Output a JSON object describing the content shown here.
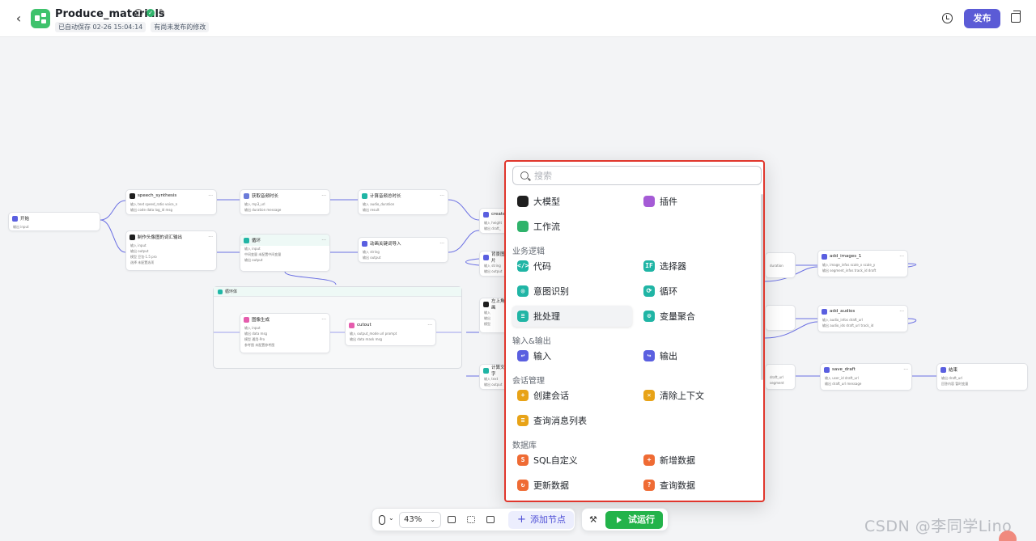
{
  "header": {
    "title": "Produce_materials",
    "autosave": "已自动保存 02-26 15:04:14",
    "unpublished": "有尚未发布的修改",
    "publish_label": "发布"
  },
  "nodes": {
    "start": {
      "title": "开始",
      "rows": [
        "输出 input"
      ]
    },
    "speech": {
      "title": "speech_synthesis",
      "rows": [
        "输入 text speed_ratio voice_n",
        "输出 code data log_id msg"
      ]
    },
    "timeline_calc": {
      "title": "获取音频时长",
      "rows": [
        "输入 mp3_url",
        "输出 duration message"
      ]
    },
    "audio_total": {
      "title": "计算音频总时长",
      "rows": [
        "输入 audio_duration",
        "输出 result"
      ]
    },
    "material_agg": {
      "title": "制作头像图的词汇输出",
      "rows": [
        "输入 input",
        "输出 output",
        "模型 豆包·1.5 pro",
        "选择 未配置选项"
      ]
    },
    "loop_node": {
      "title": "循环",
      "rows": [
        "输入 input",
        "中间变量 未配置中间变量",
        "输出 output"
      ]
    },
    "keyword": {
      "title": "动画关键词导入",
      "rows": [
        "输入 string",
        "输出 output"
      ]
    },
    "create": {
      "title": "create_",
      "rows": [
        "输入 height",
        "输出 draft_"
      ]
    },
    "bg_img": {
      "title": "背景图片",
      "rows": [
        "输入 string",
        "输出 output"
      ]
    },
    "image_gen": {
      "title": "图像生成",
      "rows": [
        "输入 input",
        "输出 data msg",
        "模型 通用-Pro",
        "参考图 未配置参考图"
      ]
    },
    "cutout": {
      "title": "cutout",
      "rows": [
        "输入 output_mode url prompt",
        "输出 data mask msg"
      ]
    },
    "left_top": {
      "title": "左上角画",
      "rows": [
        "输入",
        "输出",
        "模型"
      ]
    },
    "calc_text": {
      "title": "计算文字",
      "rows": [
        "输入 text",
        "输出 output"
      ]
    },
    "add_images": {
      "title": "add_images_1",
      "rows": [
        "输入 image_infos scale_x scale_y",
        "输出 segment_infos track_id draft"
      ]
    },
    "add_audios": {
      "title": "add_audios",
      "rows": [
        "输入 audio_infos draft_url",
        "输出 audio_ids draft_url track_id"
      ]
    },
    "save_draft": {
      "title": "save_draft",
      "rows": [
        "输入 user_id draft_url",
        "输出 draft_url message"
      ]
    },
    "end": {
      "title": "结束",
      "rows": [
        "输出 draft_url",
        "回答内容 暂时变量"
      ]
    },
    "frag_duration": {
      "rows": [
        "duration"
      ]
    },
    "frag_url": {
      "rows": [
        "draft_url",
        "segment"
      ]
    },
    "loop_frame_title": "循环体"
  },
  "popup": {
    "search_placeholder": "搜索",
    "top_items": [
      {
        "label": "大模型",
        "icon": "llm-icon",
        "color": "#1f1f1f"
      },
      {
        "label": "插件",
        "icon": "plugin-icon",
        "color": "#a55bd6"
      },
      {
        "label": "工作流",
        "icon": "workflow-icon",
        "color": "#2fb36b"
      }
    ],
    "sections": [
      {
        "title": "业务逻辑",
        "items": [
          {
            "label": "代码",
            "icon": "code-icon",
            "glyph": "</>",
            "color": "#20b5a5"
          },
          {
            "label": "选择器",
            "icon": "if-selector-icon",
            "glyph": "IF",
            "color": "#20b5a5"
          },
          {
            "label": "意图识别",
            "icon": "intent-icon",
            "glyph": "◎",
            "color": "#20b5a5"
          },
          {
            "label": "循环",
            "icon": "loop-icon",
            "glyph": "⟳",
            "color": "#20b5a5"
          },
          {
            "label": "批处理",
            "icon": "batch-icon",
            "glyph": "≡",
            "color": "#20b5a5"
          },
          {
            "label": "变量聚合",
            "icon": "variable-merge-icon",
            "glyph": "⊙",
            "color": "#20b5a5"
          }
        ]
      },
      {
        "title": "输入&输出",
        "items": [
          {
            "label": "输入",
            "icon": "input-icon",
            "glyph": "↩",
            "color": "#5a5fe0"
          },
          {
            "label": "输出",
            "icon": "output-icon",
            "glyph": "↪",
            "color": "#5a5fe0"
          }
        ]
      },
      {
        "title": "会话管理",
        "items": [
          {
            "label": "创建会话",
            "icon": "create-conversation-icon",
            "glyph": "+",
            "color": "#e8a317"
          },
          {
            "label": "清除上下文",
            "icon": "clear-context-icon",
            "glyph": "✕",
            "color": "#e8a317"
          },
          {
            "label": "查询消息列表",
            "icon": "message-list-icon",
            "glyph": "≡",
            "color": "#e8a317"
          }
        ]
      },
      {
        "title": "数据库",
        "items": [
          {
            "label": "SQL自定义",
            "icon": "sql-icon",
            "glyph": "S",
            "color": "#ef6b34"
          },
          {
            "label": "新增数据",
            "icon": "add-data-icon",
            "glyph": "+",
            "color": "#ef6b34"
          },
          {
            "label": "更新数据",
            "icon": "update-data-icon",
            "glyph": "↻",
            "color": "#ef6b34"
          },
          {
            "label": "查询数据",
            "icon": "query-data-icon",
            "glyph": "?",
            "color": "#ef6b34"
          }
        ]
      }
    ]
  },
  "toolbar": {
    "zoom": "43%",
    "add_node_label": "添加节点",
    "run_label": "试运行"
  },
  "watermark": "CSDN @李同学Lino"
}
